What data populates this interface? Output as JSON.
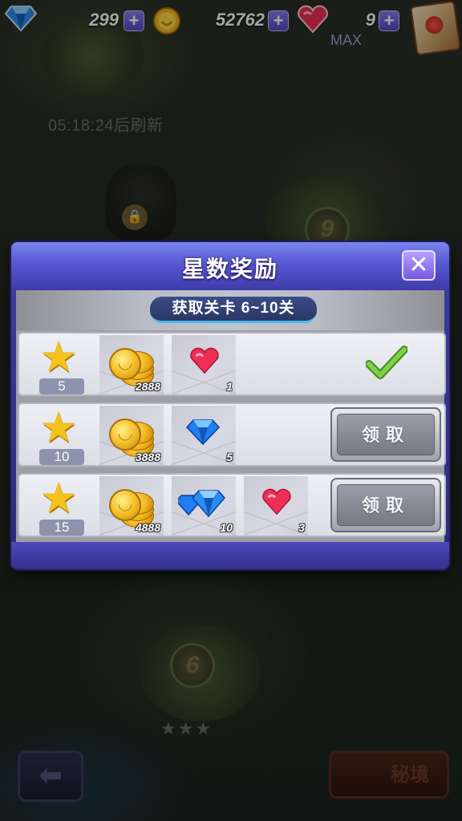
{
  "topbar": {
    "diamonds": "299",
    "coins": "52762",
    "hearts": "9",
    "hearts_max_label": "MAX",
    "plus": "+"
  },
  "background": {
    "refresh_text": "05:18:24后刷新",
    "level_9": "9",
    "level_6": "6",
    "level_6_stars": "★★★",
    "back_glyph": "⬅",
    "secret_realm_label": "秘境"
  },
  "dialog": {
    "title": "星数奖励",
    "close_glyph": "✕",
    "subtitle": "获取关卡 6~10关",
    "claim_label": "领取",
    "rows": [
      {
        "stars": "5",
        "coins": "2888",
        "items": [
          {
            "type": "heart",
            "count": "1"
          }
        ],
        "status": "claimed"
      },
      {
        "stars": "10",
        "coins": "3888",
        "items": [
          {
            "type": "diamond",
            "count": "5"
          }
        ],
        "status": "claimable"
      },
      {
        "stars": "15",
        "coins": "4888",
        "items": [
          {
            "type": "diamond",
            "count": "10"
          },
          {
            "type": "heart",
            "count": "3"
          }
        ],
        "status": "claimable"
      }
    ]
  },
  "colors": {
    "dialog_header": "#5a5ad6",
    "star": "#f6c21c",
    "check": "#6cc23a",
    "subtitle_pill": "#2a3764"
  }
}
